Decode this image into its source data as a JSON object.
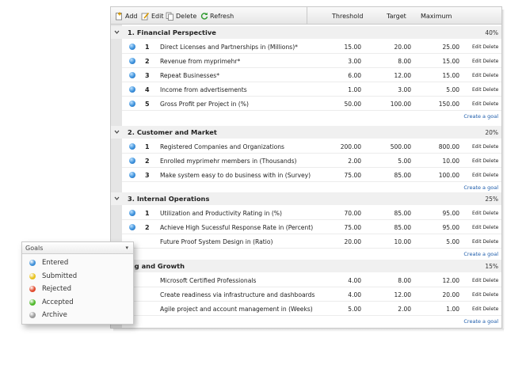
{
  "toolbar": {
    "add_label": "Add",
    "edit_label": "Edit",
    "delete_label": "Delete",
    "refresh_label": "Refresh",
    "columns": {
      "threshold": "Threshold",
      "target": "Target",
      "maximum": "Maximum"
    }
  },
  "sections": [
    {
      "title": "1. Financial Perspective",
      "percent": "40%",
      "create_label": "Create a goal",
      "rows": [
        {
          "num": "1",
          "name": "Direct Licenses and Partnerships in (Millions)*",
          "threshold": "15.00",
          "target": "20.00",
          "maximum": "25.00",
          "dot": true
        },
        {
          "num": "2",
          "name": "Revenue from myprimehr*",
          "threshold": "3.00",
          "target": "8.00",
          "maximum": "15.00",
          "dot": true
        },
        {
          "num": "3",
          "name": "Repeat Businesses*",
          "threshold": "6.00",
          "target": "12.00",
          "maximum": "15.00",
          "dot": true
        },
        {
          "num": "4",
          "name": "Income from advertisements",
          "threshold": "1.00",
          "target": "3.00",
          "maximum": "5.00",
          "dot": true
        },
        {
          "num": "5",
          "name": "Gross Profit per Project in (%)",
          "threshold": "50.00",
          "target": "100.00",
          "maximum": "150.00",
          "dot": true
        }
      ]
    },
    {
      "title": "2. Customer and Market",
      "percent": "20%",
      "create_label": "Create a goal",
      "rows": [
        {
          "num": "1",
          "name": "Registered Companies and Organizations",
          "threshold": "200.00",
          "target": "500.00",
          "maximum": "800.00",
          "dot": true
        },
        {
          "num": "2",
          "name": "Enrolled myprimehr members in (Thousands)",
          "threshold": "2.00",
          "target": "5.00",
          "maximum": "10.00",
          "dot": true
        },
        {
          "num": "3",
          "name": "Make system easy to do business with in (Survey)",
          "threshold": "75.00",
          "target": "85.00",
          "maximum": "100.00",
          "dot": true
        }
      ]
    },
    {
      "title": "3. Internal Operations",
      "percent": "25%",
      "create_label": "Create a goal",
      "rows": [
        {
          "num": "1",
          "name": "Utilization and Productivity Rating in (%)",
          "threshold": "70.00",
          "target": "85.00",
          "maximum": "95.00",
          "dot": true
        },
        {
          "num": "2",
          "name": "Achieve High Sucessful Response Rate in (Percent)",
          "threshold": "75.00",
          "target": "85.00",
          "maximum": "95.00",
          "dot": true
        },
        {
          "num": "",
          "name": "Future Proof System Design in (Ratio)",
          "threshold": "20.00",
          "target": "10.00",
          "maximum": "5.00",
          "dot": false
        }
      ]
    },
    {
      "title": "ing and Growth",
      "percent": "15%",
      "create_label": "Create a goal",
      "rows": [
        {
          "num": "",
          "name": "Microsoft Certified Professionals",
          "threshold": "4.00",
          "target": "8.00",
          "maximum": "12.00",
          "dot": false
        },
        {
          "num": "",
          "name": "Create readiness via infrastructure and dashboards",
          "threshold": "4.00",
          "target": "12.00",
          "maximum": "20.00",
          "dot": false
        },
        {
          "num": "",
          "name": "Agile project and account management in (Weeks)",
          "threshold": "5.00",
          "target": "2.00",
          "maximum": "1.00",
          "dot": false
        }
      ]
    }
  ],
  "row_actions": {
    "edit": "Edit",
    "delete": "Delete"
  },
  "legend": {
    "title": "Goals",
    "items": [
      {
        "label": "Entered",
        "color": "#3d8fd8"
      },
      {
        "label": "Submitted",
        "color": "#e8c21c"
      },
      {
        "label": "Rejected",
        "color": "#e0492c"
      },
      {
        "label": "Accepted",
        "color": "#4fb82b"
      },
      {
        "label": "Archive",
        "color": "#9a9a9a"
      }
    ]
  }
}
